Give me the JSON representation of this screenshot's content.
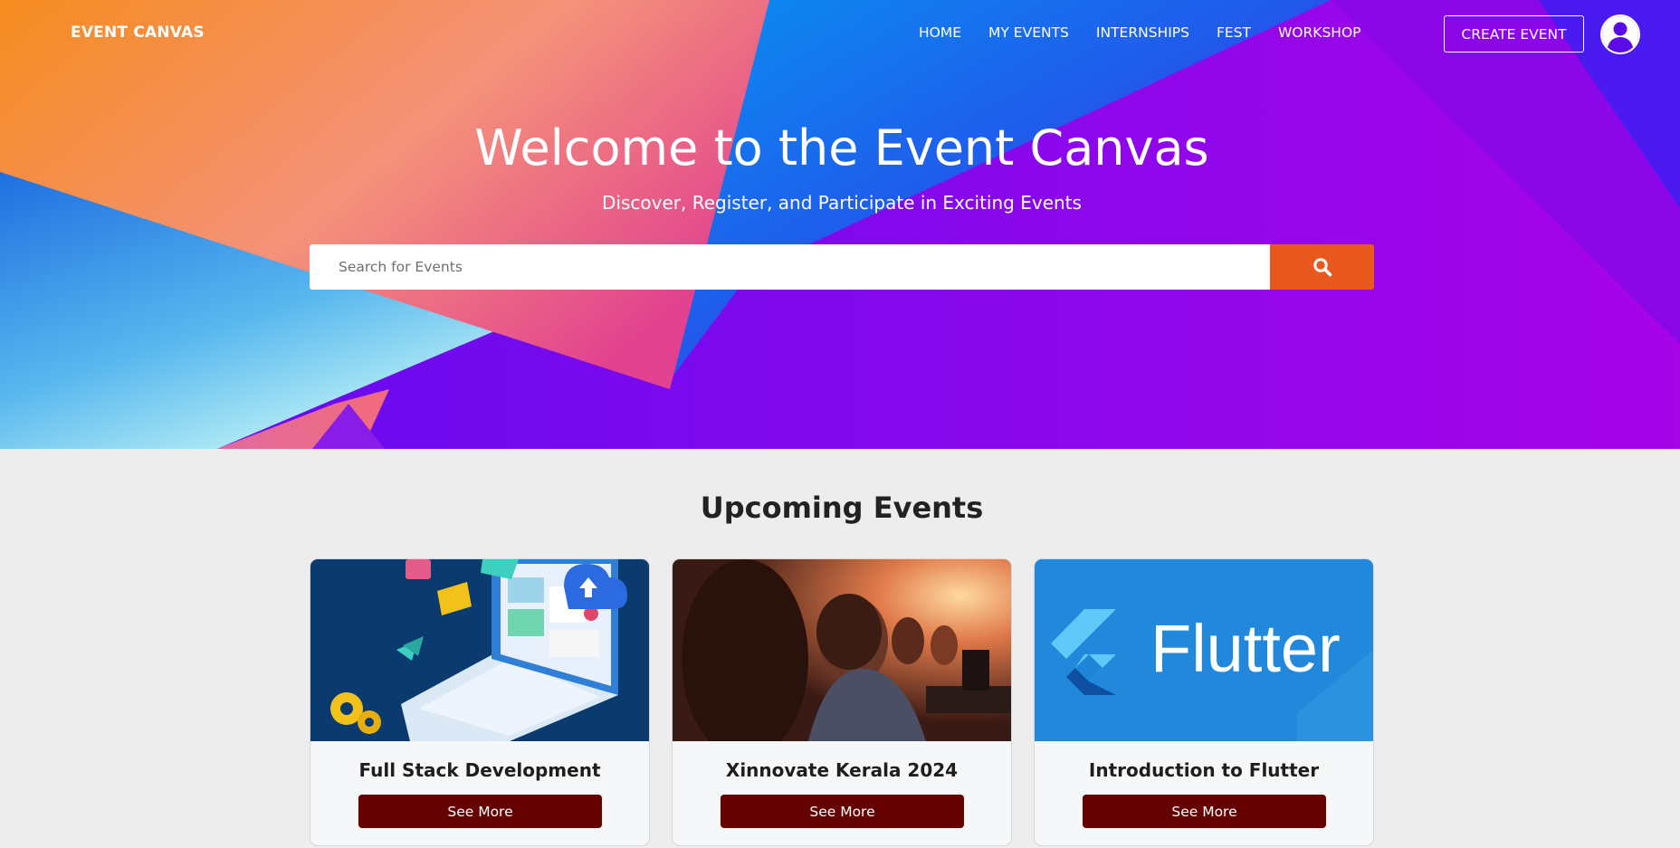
{
  "nav": {
    "brand": "EVENT CANVAS",
    "links": [
      "HOME",
      "MY EVENTS",
      "INTERNSHIPS",
      "FEST",
      "WORKSHOP"
    ],
    "create_label": "CREATE EVENT",
    "avatar_icon": "user-icon"
  },
  "hero": {
    "title": "Welcome to the Event Canvas",
    "subtitle": "Discover, Register, and Participate in Exciting Events",
    "search_placeholder": "Search for Events",
    "search_icon": "search-icon"
  },
  "events": {
    "heading": "Upcoming Events",
    "cards": [
      {
        "title": "Full Stack Development",
        "button": "See More"
      },
      {
        "title": "Xinnovate Kerala 2024",
        "button": "See More"
      },
      {
        "title": "Introduction to Flutter",
        "button": "See More",
        "image_text": "Flutter"
      }
    ]
  },
  "colors": {
    "search_button": "#e8581f",
    "see_more_button": "#640000",
    "hero_purple": "#8a06ea"
  }
}
